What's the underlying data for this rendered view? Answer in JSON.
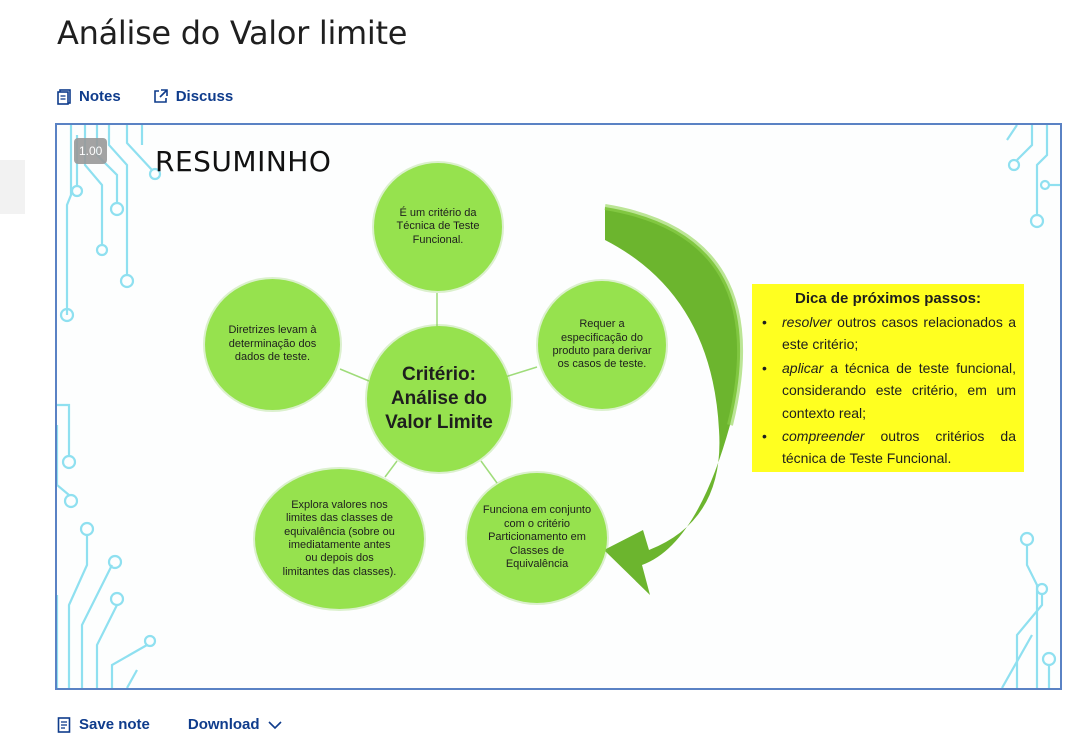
{
  "page": {
    "title": "Análise do Valor limite"
  },
  "tabs": {
    "notes": "Notes",
    "discuss": "Discuss"
  },
  "player": {
    "speed": "1.00"
  },
  "slide": {
    "title": "RESUMINHO",
    "center": "Critério: Análise do Valor Limite",
    "top": "É um critério da Técnica de Teste Funcional.",
    "right": "Requer a especificação do produto para derivar os casos de teste.",
    "left": "Diretrizes levam à determinação dos dados de teste.",
    "bottom_left": "Explora valores nos limites das classes de equivalência (sobre ou imediatamente antes ou depois dos limitantes das classes).",
    "bottom_right": "Funciona em conjunto com o critério Particionamento em Classes de Equivalência",
    "tip": {
      "heading": "Dica de próximos passos:",
      "items": [
        {
          "verb": "resolver",
          "rest": " outros casos relacionados a este critério;"
        },
        {
          "verb": "aplicar",
          "rest": " a técnica de teste funcional, considerando este critério, em um contexto real;"
        },
        {
          "verb": "compreender",
          "rest": " outros critérios da técnica de Teste Funcional."
        }
      ]
    }
  },
  "actions": {
    "save_note": "Save note",
    "download": "Download"
  },
  "colors": {
    "accent": "#0f3c8c",
    "circle": "#96e24e",
    "tip_bg": "#ffff20",
    "arrow": "#6cb52e",
    "circuit": "#8fe0f0"
  }
}
